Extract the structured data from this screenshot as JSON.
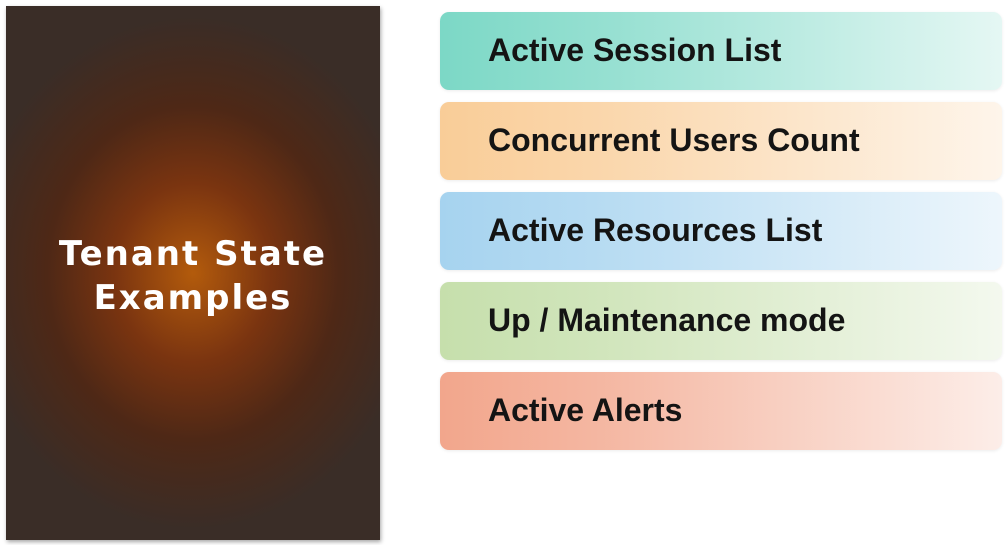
{
  "panel": {
    "title_line1": "Tenant State",
    "title_line2": "Examples"
  },
  "items": [
    {
      "label": "Active Session List",
      "color": "#7cd8c6"
    },
    {
      "label": "Concurrent Users Count",
      "color": "#f9cd98"
    },
    {
      "label": "Active Resources List",
      "color": "#a6d3ef"
    },
    {
      "label": "Up / Maintenance mode",
      "color": "#c6dfac"
    },
    {
      "label": "Active Alerts",
      "color": "#f2a68c"
    }
  ]
}
